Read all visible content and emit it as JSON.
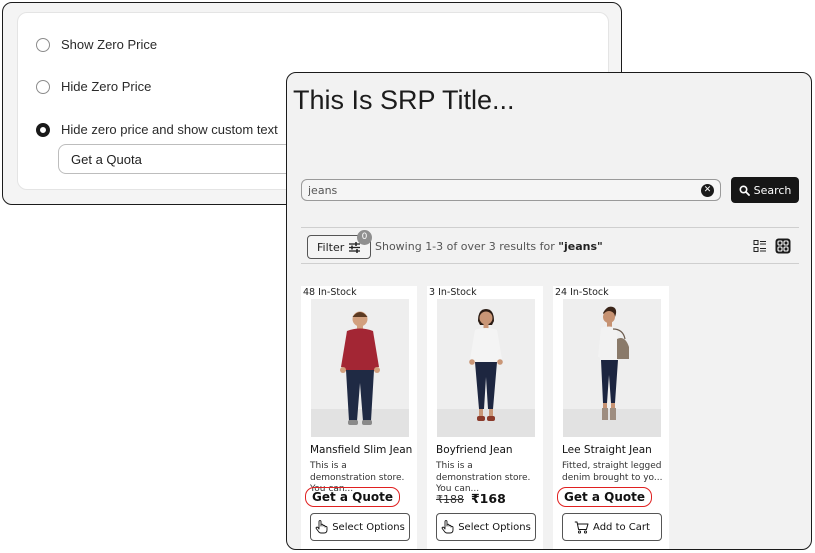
{
  "settings": {
    "options": [
      {
        "label": "Show Zero Price",
        "checked": false
      },
      {
        "label": "Hide Zero Price",
        "checked": false
      },
      {
        "label": "Hide zero price and show custom text",
        "checked": true
      }
    ],
    "custom_text_value": "Get a Quota"
  },
  "srp": {
    "title": "This Is SRP Title...",
    "search": {
      "value": "jeans",
      "button_label": "Search",
      "clear_icon": "close-circle-icon",
      "search_icon": "magnifier-icon"
    },
    "filter": {
      "label": "Filter",
      "badge": "0",
      "icon": "sliders-icon"
    },
    "results": {
      "prefix": "Showing 1-3 of over 3 results for",
      "query": "\"jeans\""
    },
    "view_icons": [
      "list-view-icon",
      "grid-view-icon"
    ],
    "products": [
      {
        "stock": "48 In-Stock",
        "name": "Mansfield Slim Jean",
        "desc": "This is a demonstration store. You can...",
        "quote": "Get a Quote",
        "action": "Select Options",
        "action_icon": "pointer-hand-icon",
        "colors": {
          "top": "#a32634",
          "pants": "#1f2a44",
          "skin": "#d2a07e",
          "hair": "#5b3a22",
          "shoes": "#8a8a8a"
        }
      },
      {
        "stock": "3 In-Stock",
        "name": "Boyfriend Jean",
        "desc": "This is a demonstration store. You can...",
        "price_old": "₹188",
        "price_new": "₹168",
        "action": "Select Options",
        "action_icon": "pointer-hand-icon",
        "colors": {
          "top": "#f4f4f4",
          "pants": "#1d2640",
          "skin": "#c99676",
          "hair": "#2b1c14",
          "shoes": "#8b3a2a"
        }
      },
      {
        "stock": "24 In-Stock",
        "name": "Lee Straight Jean",
        "desc": "Fitted, straight legged denim brought to yo...",
        "quote": "Get a Quote",
        "action": "Add to Cart",
        "action_icon": "cart-icon",
        "colors": {
          "top": "#f2f2f2",
          "pants": "#1c2540",
          "skin": "#c69272",
          "hair": "#3a2418",
          "shoes": "#9e8d80",
          "bag": "#8a7a6a"
        }
      }
    ]
  }
}
